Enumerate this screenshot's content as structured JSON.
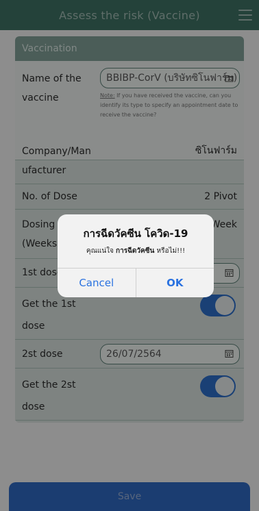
{
  "header": {
    "title": "Assess the risk (Vaccine)",
    "menu_icon": "hamburger-menu-icon"
  },
  "card": {
    "title": "Vaccination"
  },
  "fields": {
    "vaccine_name": {
      "label_line1": "Name of the",
      "label_line2": "vaccine",
      "value": "BBIBP-CorV (บริษัทซิโนฟาร์ม)",
      "note_prefix": "Note:",
      "note_text": " If you have received the vaccine, can you identify its type to specify an appointment date to receive the vaccine?"
    },
    "manufacturer": {
      "label_line1": "Company/Man",
      "label_line2": "ufacturer",
      "value": "ซิโนฟาร์ม"
    },
    "doses": {
      "label": "No. of Dose",
      "value": "2 Pivot"
    },
    "interval": {
      "label_line1": "Dosing",
      "label_line2": "(Weeks)",
      "value": "3 Week"
    },
    "first_dose": {
      "label": "1st dose",
      "value": ""
    },
    "got_first": {
      "label_line1": "Get the 1st",
      "label_line2": "dose",
      "checked": true
    },
    "second_dose": {
      "label": "2st dose",
      "value": "26/07/2564"
    },
    "got_second": {
      "label_line1": "Get the 2st",
      "label_line2": "dose",
      "checked": true
    }
  },
  "save_button": {
    "label": "Save"
  },
  "dialog": {
    "title": "การฉีดวัคซีน โควิด-19",
    "message_prefix": "คุณแน่ใจ ",
    "message_bold": "การฉีดวัคซีน",
    "message_suffix": " หรือไม่!!!",
    "cancel_label": "Cancel",
    "ok_label": "OK"
  },
  "colors": {
    "header_bg": "#3c6f61",
    "toggle_on": "#2c6cc4",
    "dialog_button_text": "#2a72e0",
    "save_bg": "#2e66bc"
  }
}
